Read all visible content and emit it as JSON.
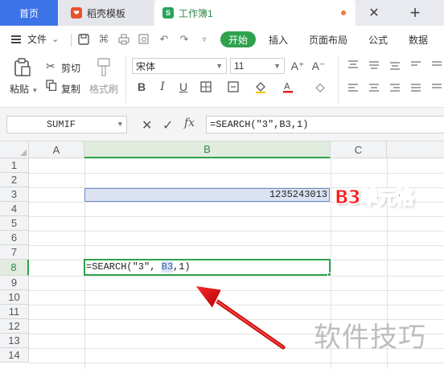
{
  "tabs": {
    "home": "首页",
    "docer": "稻壳模板",
    "doc": "工作簿1",
    "doc_icon": "S",
    "new_tab": "+"
  },
  "menu": {
    "file": "文件",
    "file_arrow": "⌄",
    "items": [
      "开始",
      "插入",
      "页面布局",
      "公式",
      "数据"
    ]
  },
  "ribbon": {
    "paste": "粘贴",
    "cut": "剪切",
    "copy": "复制",
    "format_painter": "格式刷",
    "font_name": "宋体",
    "font_size": "11",
    "bold": "B",
    "italic": "I",
    "underline": "U",
    "font_grow": "A⁺",
    "font_shrink": "A⁻"
  },
  "formula_bar": {
    "name_box": "SUMIF",
    "cancel": "✕",
    "confirm": "✓",
    "fx": "fx",
    "formula": "=SEARCH(″3″,B3,1)"
  },
  "grid": {
    "columns": [
      "A",
      "B",
      "C"
    ],
    "rows": [
      "1",
      "2",
      "3",
      "4",
      "5",
      "6",
      "7",
      "8",
      "9",
      "10",
      "11",
      "12",
      "13",
      "14"
    ],
    "b3_value": "1235243013",
    "b8_prefix": "=SEARCH(″3″, ",
    "b8_ref": "B3",
    "b8_suffix": ",1)"
  },
  "annotation": {
    "label": "B3单元格",
    "watermark": "软件技巧"
  },
  "colors": {
    "accent_green": "#2ea24d",
    "home_tab": "#3c74e8",
    "annotation_red": "#ff1a1a",
    "selection_blue": "#dbe3f3"
  }
}
